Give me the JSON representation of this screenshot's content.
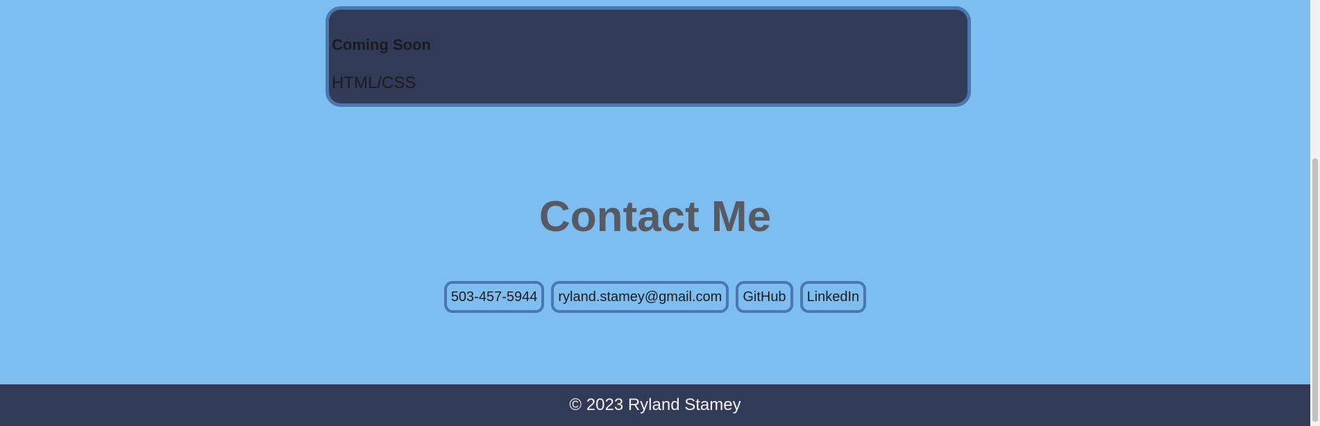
{
  "project": {
    "title": "Coming Soon",
    "tech": "HTML/CSS"
  },
  "contact": {
    "heading": "Contact Me",
    "links": [
      {
        "label": "503-457-5944"
      },
      {
        "label": "ryland.stamey@gmail.com"
      },
      {
        "label": "GitHub"
      },
      {
        "label": "LinkedIn"
      }
    ]
  },
  "footer": {
    "text": "© 2023 Ryland Stamey"
  },
  "colors": {
    "background": "#7dbdef",
    "card": "#313a57",
    "border_accent": "#4a78ae",
    "heading": "#555a63"
  }
}
